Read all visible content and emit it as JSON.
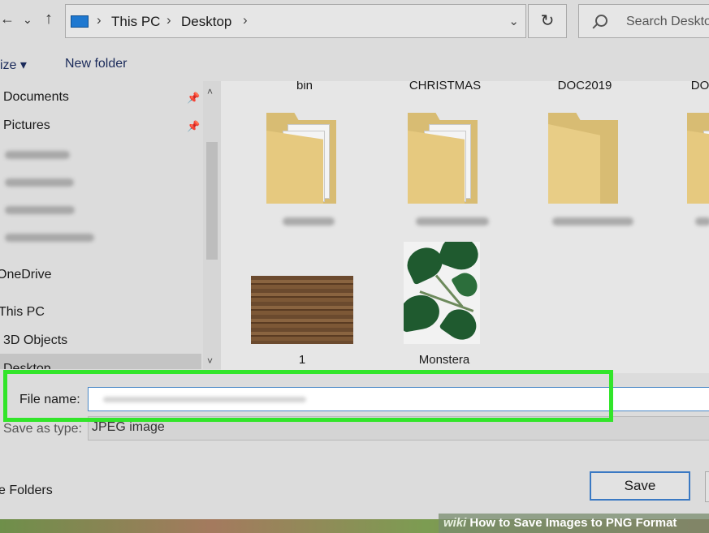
{
  "nav": {
    "back_glyph": "←",
    "dropdown_glyph": "⌄",
    "up_glyph": "↑"
  },
  "address": {
    "crumbs": [
      "This PC",
      "Desktop"
    ],
    "separator": "›",
    "dropdown_glyph": "⌄"
  },
  "refresh_glyph": "↻",
  "search": {
    "placeholder": "Search Desktop"
  },
  "toolbar": {
    "organize_label": "ize ▾",
    "new_folder_label": "New folder"
  },
  "sidebar": {
    "items": [
      {
        "label": "Documents"
      },
      {
        "label": "Pictures"
      },
      {
        "label": "OneDrive"
      },
      {
        "label": "This PC"
      },
      {
        "label": "3D Objects"
      },
      {
        "label": "Desktop"
      }
    ],
    "pin_glyph": "📌",
    "scroll_up": "˄",
    "scroll_down": "˅"
  },
  "files": {
    "top_row_names": [
      "bin",
      "CHRISTMAS",
      "DOC2019",
      "DO"
    ],
    "items": [
      {
        "name": "1",
        "kind": "image-wood"
      },
      {
        "name": "Monstera",
        "kind": "image-plant"
      }
    ]
  },
  "save_form": {
    "file_name_label": "File name:",
    "file_name_value": "",
    "save_type_label": "Save as type:",
    "save_type_value": "JPEG image",
    "hide_folders_label": "e Folders",
    "save_button": "Save"
  },
  "watermark": {
    "brand": "wiki",
    "title": "How to Save Images to PNG Format"
  },
  "colors": {
    "highlight": "#32e52a",
    "accent": "#3a79c3",
    "folder": "#e6c97f"
  }
}
